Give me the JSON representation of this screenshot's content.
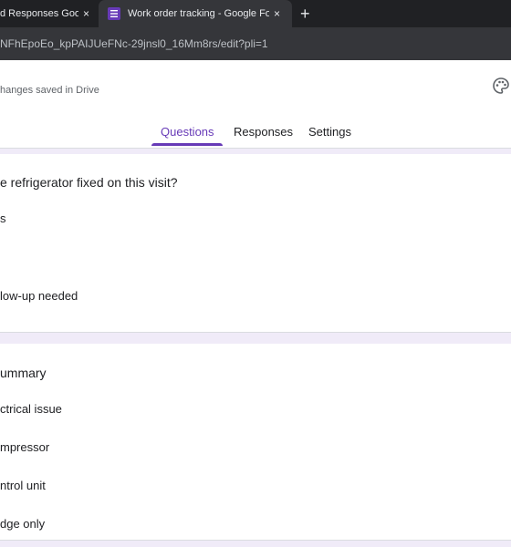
{
  "browser": {
    "tabs": [
      {
        "title": "d Responses Goo"
      },
      {
        "title": "Work order tracking - Google For"
      }
    ],
    "close_glyph": "×",
    "new_tab_glyph": "+",
    "url": "NFhEpoEo_kpPAIJUeFNc-29jnsl0_16Mm8rs/edit?pli=1"
  },
  "header": {
    "save_status": "hanges saved in Drive",
    "palette_icon": "palette-icon"
  },
  "nav": {
    "questions": "Questions",
    "responses": "Responses",
    "settings": "Settings"
  },
  "question1": {
    "title": "e refrigerator fixed on this visit?",
    "options": [
      "s",
      "low-up needed"
    ]
  },
  "question2": {
    "title": "ummary",
    "options": [
      "ctrical issue",
      "mpressor",
      "ntrol unit",
      "dge only"
    ]
  },
  "colors": {
    "accent": "#673ab7",
    "page_bg": "#f0ebf8",
    "tabbar_bg": "#202124"
  }
}
